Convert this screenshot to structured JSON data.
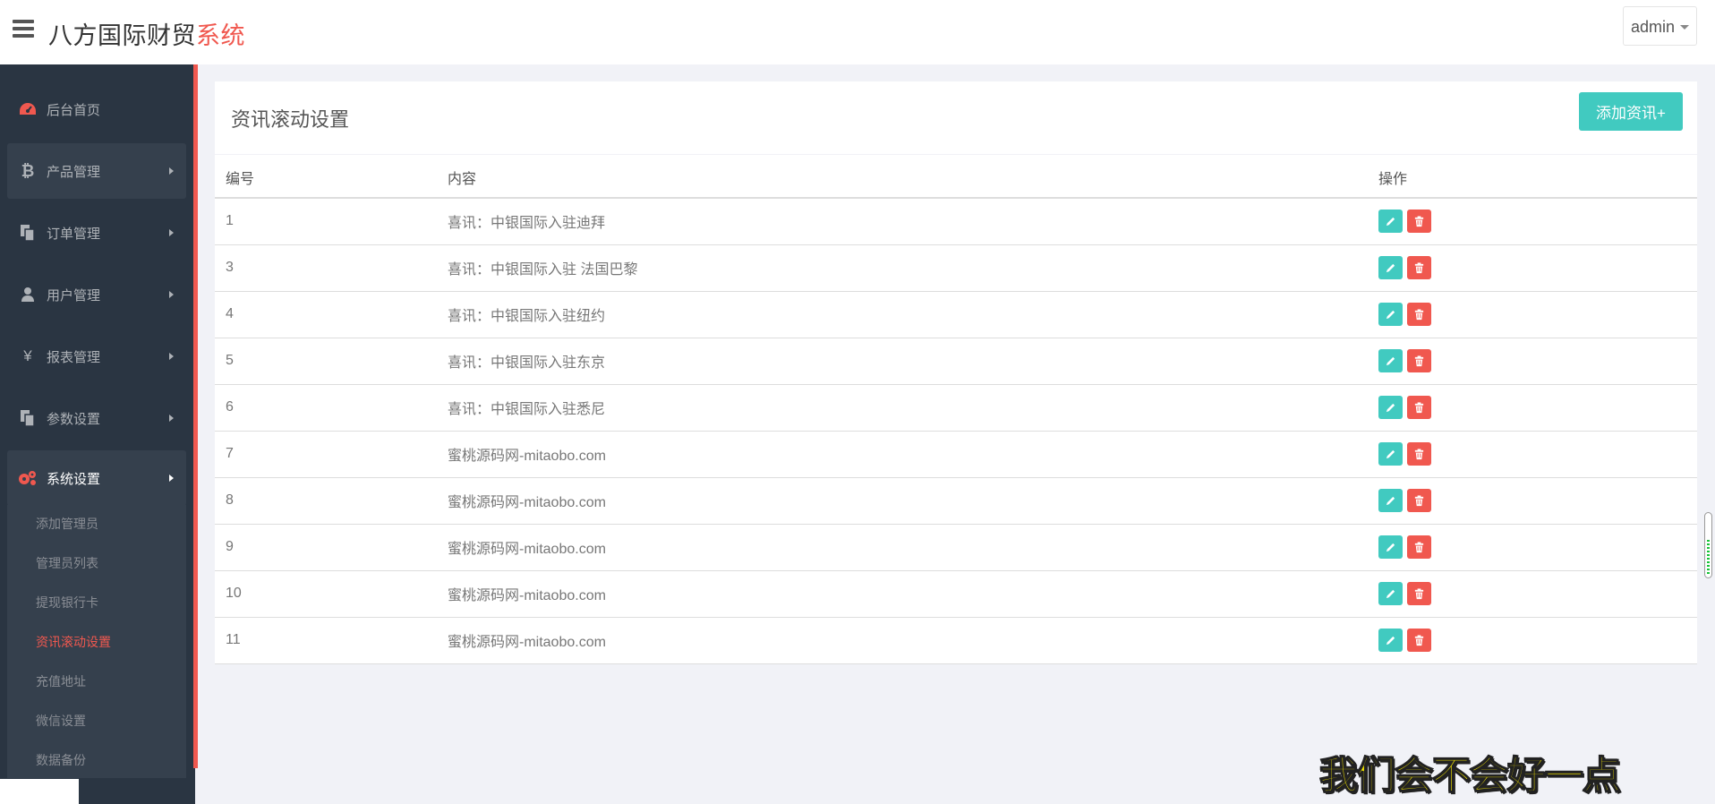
{
  "header": {
    "brand_main": "八方国际财贸",
    "brand_accent": "系统",
    "user": "admin"
  },
  "sidebar": {
    "items": [
      {
        "label": "后台首页",
        "icon": "dashboard-icon"
      },
      {
        "label": "产品管理",
        "icon": "bitcoin-icon"
      },
      {
        "label": "订单管理",
        "icon": "copy-icon"
      },
      {
        "label": "用户管理",
        "icon": "user-icon"
      },
      {
        "label": "报表管理",
        "icon": "yen-icon"
      },
      {
        "label": "参数设置",
        "icon": "copy-icon"
      },
      {
        "label": "系统设置",
        "icon": "gears-icon"
      }
    ],
    "submenu": [
      "添加管理员",
      "管理员列表",
      "提现银行卡",
      "资讯滚动设置",
      "充值地址",
      "微信设置",
      "数据备份"
    ]
  },
  "main": {
    "title": "资讯滚动设置",
    "add_label": "添加资讯+",
    "columns": [
      "编号",
      "内容",
      "操作"
    ],
    "rows": [
      {
        "id": "1",
        "content": "喜讯：中银国际入驻迪拜"
      },
      {
        "id": "3",
        "content": "喜讯：中银国际入驻 法国巴黎"
      },
      {
        "id": "4",
        "content": "喜讯：中银国际入驻纽约"
      },
      {
        "id": "5",
        "content": "喜讯：中银国际入驻东京"
      },
      {
        "id": "6",
        "content": "喜讯：中银国际入驻悉尼"
      },
      {
        "id": "7",
        "content": "蜜桃源码网-mitaobo.com"
      },
      {
        "id": "8",
        "content": "蜜桃源码网-mitaobo.com"
      },
      {
        "id": "9",
        "content": "蜜桃源码网-mitaobo.com"
      },
      {
        "id": "10",
        "content": "蜜桃源码网-mitaobo.com"
      },
      {
        "id": "11",
        "content": "蜜桃源码网-mitaobo.com"
      }
    ]
  },
  "subtitle": "我们会不会好一点",
  "colors": {
    "accent": "#f0584f",
    "teal": "#41cac0",
    "sidebar": "#2a3542"
  }
}
